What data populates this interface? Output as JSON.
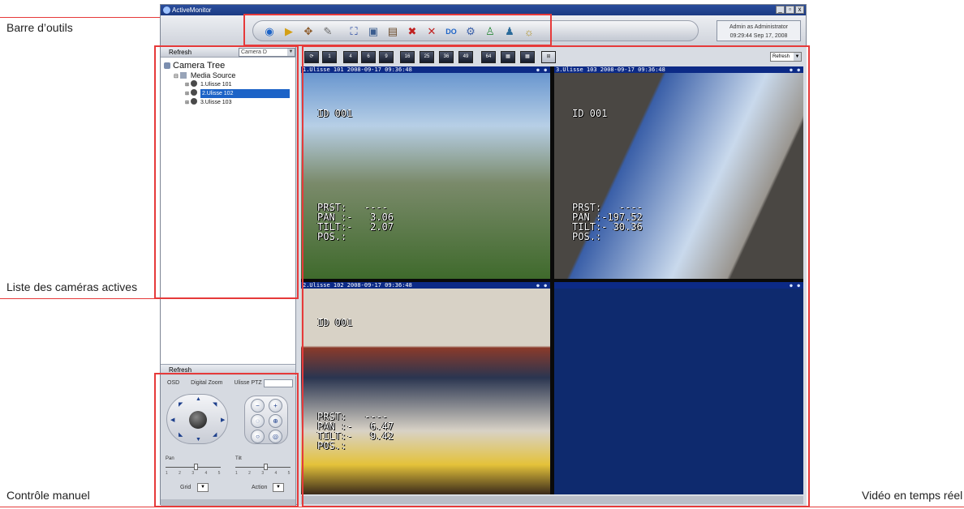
{
  "annotations": {
    "toolbar": "Barre d’outils",
    "camera_list": "Liste des caméras actives",
    "manual_control": "Contrôle manuel",
    "live_video": "Vidéo en temps réel"
  },
  "window": {
    "title": "ActiveMonitor",
    "buttons": [
      "_",
      "▫",
      "x"
    ],
    "user": "Admin as Administrator",
    "datetime": "09:29:44 Sep 17, 2008"
  },
  "camera_tree": {
    "refresh_label": "Refresh",
    "selected_camera": "Camera D",
    "root": "Camera Tree",
    "group": "Media Source",
    "items": [
      "1.Ulisse 101",
      "2.Ulisse 102",
      "3.Ulisse 103"
    ],
    "selected_index": 1,
    "footer_refresh": "Refresh"
  },
  "ptz": {
    "tabs": [
      "OSD",
      "Digital Zoom",
      "Ulisse PTZ"
    ],
    "pan_label": "Pan",
    "tilt_label": "Tilt",
    "tick_labels": "1 2 3 4 5",
    "grid_label": "Grid",
    "action_label": "Action",
    "pan_level": 0.55,
    "tilt_level": 0.55
  },
  "video": {
    "refresh_combo": "Refresh",
    "layout_buttons": [
      "1",
      "4",
      "6",
      "9",
      "16",
      "25",
      "36",
      "49",
      "64"
    ],
    "cells": [
      {
        "header": "1.Ulisse 101  2008-09-17 09:36:48",
        "id": "ID 001",
        "osd": "PRST:   ----\nPAN :-   3.06\nTILT:-   2.07\nPOS.:",
        "colors": [
          "#5f8fcc",
          "#b7cfe6",
          "#7a8a6a",
          "#3f6a2c"
        ]
      },
      {
        "header": "3.Ulisse 103  2008-09-17 09:36:48",
        "id": "ID 001",
        "osd": "PRST:   ----\nPAN :-197.52\nTILT:- 30.36\nPOS.:",
        "colors": [
          "#3a5fa8",
          "#c9d9ec",
          "#4a4743",
          "#9a9690"
        ]
      },
      {
        "header": "2.Ulisse 102  2008-09-17 09:36:48",
        "id": "ID 001",
        "osd": "PRST:   ----\nPAN :-   6.47\nTILT:-   9.42\nPOS.:",
        "colors": [
          "#d8d2c6",
          "#8a3a2a",
          "#2a3550",
          "#e4c23a"
        ]
      },
      {
        "header": "",
        "id": "",
        "osd": "",
        "colors": [
          "#0e2a6e",
          "#0e2a6e",
          "#0e2a6e",
          "#0e2a6e"
        ]
      }
    ]
  },
  "theme": {
    "annotation_red": "#e63a3a",
    "title_blue": "#1b3a82",
    "selection_blue": "#1c63c7"
  }
}
